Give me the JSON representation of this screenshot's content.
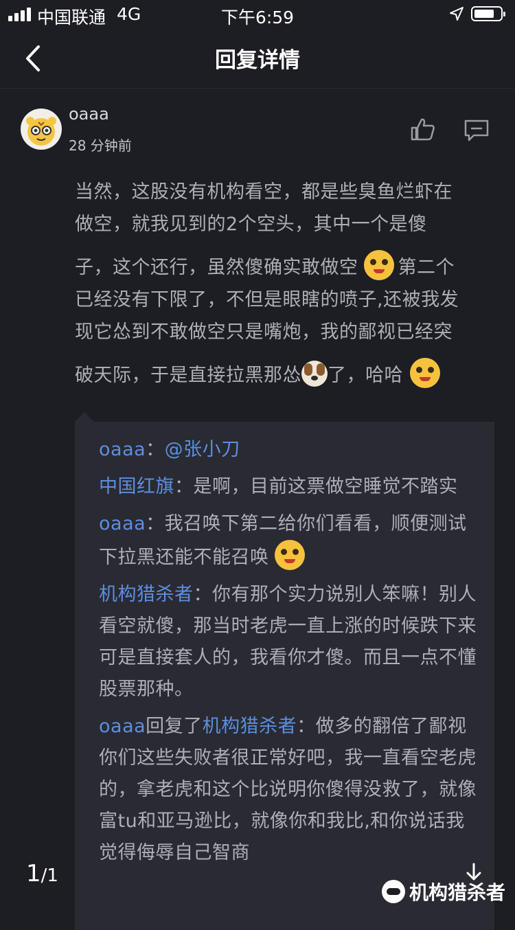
{
  "status": {
    "carrier": "中国联通",
    "network": "4G",
    "time": "下午6:59"
  },
  "nav": {
    "title": "回复详情"
  },
  "post": {
    "username": "oaaa",
    "time_ago": "28 分钟前",
    "lines": [
      "当然，这股没有机构看空，都是些臭鱼烂虾在",
      "做空，就我见到的2个空头，其中一个是傻",
      "子，这个还行，虽然傻确实敢做空",
      "第二个",
      "已经没有下限了，不但是眼瞎的喷子,还被我发",
      "现它怂到不敢做空只是嘴炮，我的鄙视已经突",
      "破天际，于是直接拉黑那怂",
      "了，哈哈"
    ]
  },
  "replies": [
    {
      "author": "oaaa",
      "sep": "：",
      "text": "@张小刀",
      "text_is_link": true
    },
    {
      "author": "中国红旗",
      "sep": "：",
      "text": "是啊，目前这票做空睡觉不踏实"
    },
    {
      "author": "oaaa",
      "sep": "：",
      "text": "我召唤下第二给你们看看，顺便测试下拉黑还能不能召唤"
    },
    {
      "author": "机构猎杀者",
      "sep": "：",
      "text": "你有那个实力说别人笨嘛！别人看空就傻，那当时老虎一直上涨的时候跌下来可是直接套人的，我看你才傻。而且一点不懂股票那种。"
    },
    {
      "author": "oaaa",
      "reply_word": "回复了",
      "target": "机构猎杀者",
      "sep": "：",
      "text": "做多的翻倍了鄙视你们这些失败者很正常好吧，我一直看空老虎的，拿老虎和这个比说明你傻得没救了，就像富tu和亚马逊比，就像你和我比,和你说话我觉得侮辱自己智商"
    }
  ],
  "pager": {
    "current": "1",
    "total": "/1"
  },
  "watermark": "机构猎杀者",
  "colors": {
    "background": "#1d1d24",
    "quote_bg": "#2a2a33",
    "link": "#5b8fe0",
    "text": "#aeaeb6"
  }
}
